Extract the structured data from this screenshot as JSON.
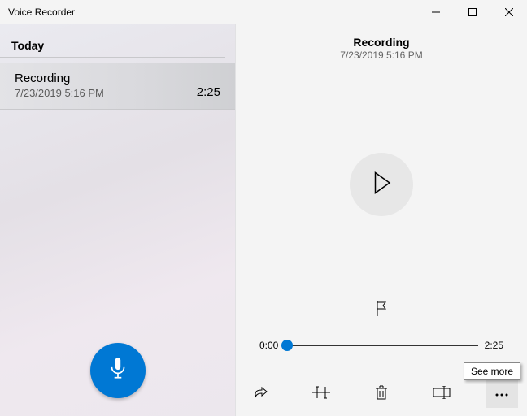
{
  "window": {
    "title": "Voice Recorder"
  },
  "sidebar": {
    "section_label": "Today",
    "items": [
      {
        "name": "Recording",
        "datetime": "7/23/2019 5:16 PM",
        "duration": "2:25"
      }
    ]
  },
  "panel": {
    "name": "Recording",
    "datetime": "7/23/2019 5:16 PM",
    "current_time": "0:00",
    "total_time": "2:25"
  },
  "tooltip": {
    "see_more": "See more"
  }
}
